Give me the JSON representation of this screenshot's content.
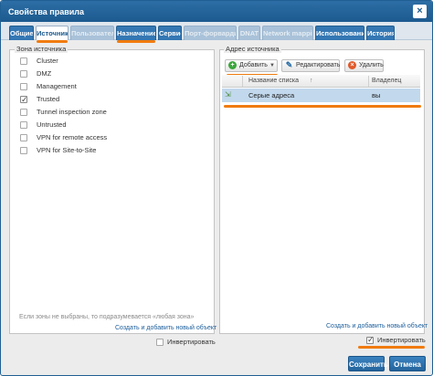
{
  "window": {
    "title": "Свойства правила",
    "close_glyph": "×"
  },
  "tabs": [
    {
      "label": "Общие",
      "state": "normal"
    },
    {
      "label": "Источник",
      "state": "active"
    },
    {
      "label": "Пользователи",
      "state": "disabled"
    },
    {
      "label": "Назначение",
      "state": "normal"
    },
    {
      "label": "Сервис",
      "state": "normal"
    },
    {
      "label": "Порт-форвардинг",
      "state": "disabled"
    },
    {
      "label": "DNAT",
      "state": "disabled"
    },
    {
      "label": "Network mapping",
      "state": "disabled"
    },
    {
      "label": "Использование",
      "state": "normal"
    },
    {
      "label": "История",
      "state": "normal"
    }
  ],
  "zone_panel": {
    "legend": "Зона источника",
    "items": [
      {
        "label": "Cluster",
        "checked": false
      },
      {
        "label": "DMZ",
        "checked": false
      },
      {
        "label": "Management",
        "checked": false
      },
      {
        "label": "Trusted",
        "checked": true
      },
      {
        "label": "Tunnel inspection zone",
        "checked": false
      },
      {
        "label": "Untrusted",
        "checked": false
      },
      {
        "label": "VPN for remote access",
        "checked": false
      },
      {
        "label": "VPN for Site-to-Site",
        "checked": false
      }
    ],
    "hint": "Если зоны не выбраны, то подразумевается «любая зона»",
    "create_link": "Создать и добавить новый объект",
    "invert_label": "Инвертировать",
    "invert_checked": false
  },
  "address_panel": {
    "legend": "Адрес источника",
    "toolbar": {
      "add_label": "Добавить",
      "edit_label": "Редактировать",
      "delete_label": "Удалить"
    },
    "columns": {
      "name": "Название списка",
      "owner": "Владелец",
      "sort_glyph": "↑"
    },
    "rows": [
      {
        "name": "Серые адреса",
        "owner": "вы"
      }
    ],
    "create_link": "Создать и добавить новый объект",
    "invert_label": "Инвертировать",
    "invert_checked": true
  },
  "footer": {
    "save_label": "Сохранить",
    "cancel_label": "Отмена"
  },
  "colors": {
    "accent": "#2c6ea6",
    "highlight": "#f07b0f",
    "selected_row": "#c2d8ec"
  }
}
